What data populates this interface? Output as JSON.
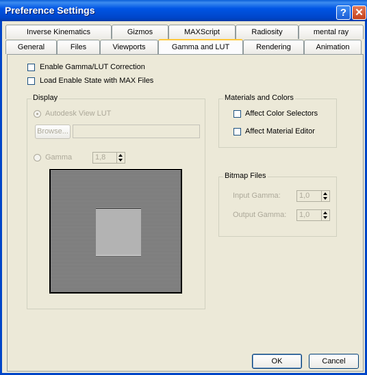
{
  "window": {
    "title": "Preference Settings",
    "help_label": "?",
    "close_label": "✕"
  },
  "tabs_row1": [
    "Inverse Kinematics",
    "Gizmos",
    "MAXScript",
    "Radiosity",
    "mental ray"
  ],
  "tabs_row2": [
    "General",
    "Files",
    "Viewports",
    "Gamma and LUT",
    "Rendering",
    "Animation"
  ],
  "active_tab": "Gamma and LUT",
  "options": {
    "enable_gamma": {
      "label": "Enable Gamma/LUT Correction",
      "checked": false
    },
    "load_enable": {
      "label": "Load Enable State with MAX Files",
      "checked": false
    }
  },
  "display": {
    "legend": "Display",
    "lut_label": "Autodesk View LUT",
    "browse_label": "Browse...",
    "lut_path": "",
    "gamma_label": "Gamma",
    "gamma_value": "1,8"
  },
  "materials": {
    "legend": "Materials and Colors",
    "affect_color_selectors": "Affect Color Selectors",
    "affect_material_editor": "Affect Material Editor"
  },
  "bitmap": {
    "legend": "Bitmap Files",
    "input_label": "Input Gamma:",
    "input_value": "1,0",
    "output_label": "Output Gamma:",
    "output_value": "1,0"
  },
  "buttons": {
    "ok": "OK",
    "cancel": "Cancel"
  }
}
